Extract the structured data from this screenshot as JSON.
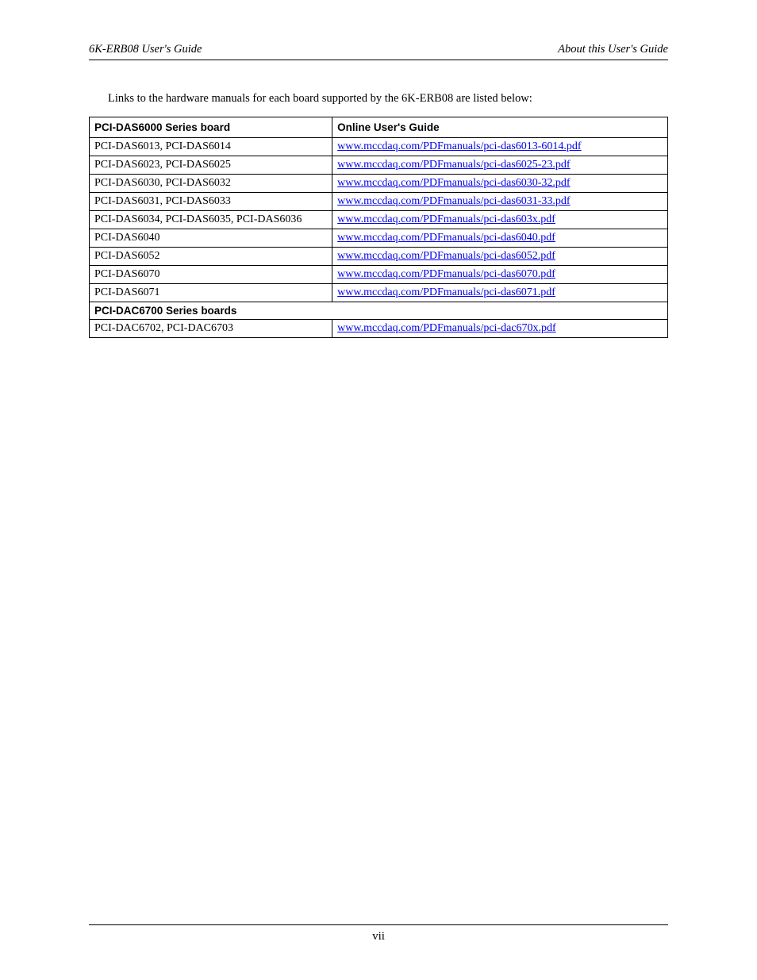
{
  "header": {
    "left": "6K-ERB08 User's Guide",
    "right": "About this User's Guide"
  },
  "intro": "Links to the hardware manuals for each board supported by the 6K-ERB08 are listed below:",
  "table": {
    "headers": {
      "board": "PCI-DAS6000 Series board",
      "guide": "Online User's Guide"
    },
    "rows": [
      {
        "board": "PCI-DAS6013, PCI-DAS6014",
        "link": "www.mccdaq.com/PDFmanuals/pci-das6013-6014.pdf"
      },
      {
        "board": "PCI-DAS6023, PCI-DAS6025",
        "link": "www.mccdaq.com/PDFmanuals/pci-das6025-23.pdf"
      },
      {
        "board": "PCI-DAS6030, PCI-DAS6032",
        "link": "www.mccdaq.com/PDFmanuals/pci-das6030-32.pdf"
      },
      {
        "board": "PCI-DAS6031, PCI-DAS6033",
        "link": "www.mccdaq.com/PDFmanuals/pci-das6031-33.pdf"
      },
      {
        "board": "PCI-DAS6034, PCI-DAS6035, PCI-DAS6036",
        "link": "www.mccdaq.com/PDFmanuals/pci-das603x.pdf"
      },
      {
        "board": "PCI-DAS6040",
        "link": "www.mccdaq.com/PDFmanuals/pci-das6040.pdf"
      },
      {
        "board": "PCI-DAS6052",
        "link": "www.mccdaq.com/PDFmanuals/pci-das6052.pdf"
      },
      {
        "board": "PCI-DAS6070",
        "link": "www.mccdaq.com/PDFmanuals/pci-das6070.pdf"
      },
      {
        "board": "PCI-DAS6071",
        "link": "www.mccdaq.com/PDFmanuals/pci-das6071.pdf"
      }
    ],
    "section2": "PCI-DAC6700 Series boards",
    "rows2": [
      {
        "board": "PCI-DAC6702, PCI-DAC6703",
        "link": "www.mccdaq.com/PDFmanuals/pci-dac670x.pdf"
      }
    ]
  },
  "footer": "vii"
}
